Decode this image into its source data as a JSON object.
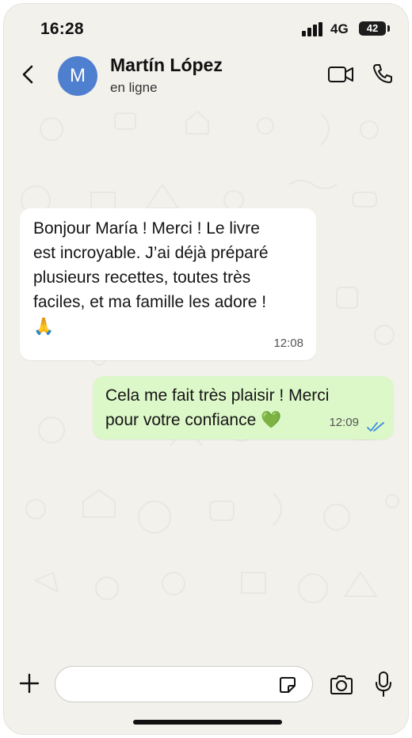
{
  "status_bar": {
    "time": "16:28",
    "network": "4G",
    "battery": "42",
    "icons": [
      "signal-bars-icon",
      "battery-icon"
    ]
  },
  "header": {
    "avatar_initial": "M",
    "contact_name": "Martín López",
    "contact_status": "en ligne",
    "icons": [
      "chevron-left-icon",
      "video-camera-icon",
      "phone-icon"
    ]
  },
  "messages": [
    {
      "direction": "incoming",
      "text": "Bonjour María ! Merci ! Le livre\nest incroyable. J’ai déjà préparé\nplusieurs recettes, toutes très\nfaciles, et ma famille les adore !",
      "emoji": "🙏",
      "time": "12:08"
    },
    {
      "direction": "outgoing",
      "text": "Cela me fait très plaisir ! Merci\npour votre confiance ",
      "emoji": "💚",
      "time": "12:09",
      "status": "read"
    }
  ],
  "composer": {
    "value": "",
    "icons": [
      "plus-icon",
      "sticker-icon",
      "camera-icon",
      "microphone-icon"
    ]
  },
  "colors": {
    "background": "#f3f1ec",
    "incoming_bubble": "#ffffff",
    "outgoing_bubble": "#dcf7c8",
    "avatar": "#4f7fcf",
    "read_ticks": "#3b8fe0"
  }
}
